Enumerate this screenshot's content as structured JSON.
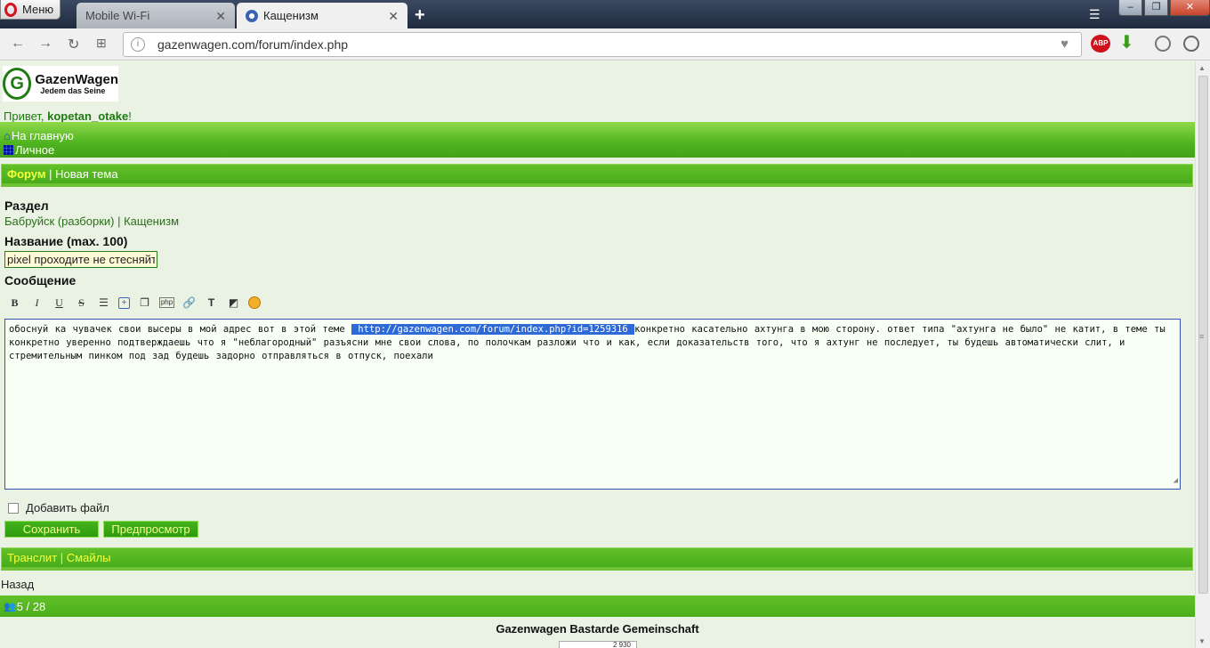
{
  "browser": {
    "menu_label": "Меню",
    "tabs": [
      {
        "title": "Mobile Wi-Fi",
        "active": false
      },
      {
        "title": "Кащенизм",
        "active": true
      }
    ],
    "url": "gazenwagen.com/forum/index.php"
  },
  "site": {
    "logo_name": "GazenWagen",
    "logo_slogan": "Jedem das Seine",
    "greeting_prefix": "Привет, ",
    "username": "kopetan_otake",
    "greeting_suffix": "!",
    "nav": {
      "home": "На главную",
      "personal": "Личное"
    }
  },
  "breadcrumb": {
    "forum": "Форум",
    "sep": " | ",
    "new_topic": "Новая тема"
  },
  "form": {
    "section_label": "Раздел",
    "section_path": "Бабруйск (разборки) | Кащенизм",
    "title_label": "Название (max. 100)",
    "title_value": "pixel проходите не стесняйт",
    "message_label": "Сообщение",
    "toolbar": [
      "B",
      "I",
      "U",
      "S",
      "list",
      "spoiler",
      "copy",
      "php",
      "link",
      "text-color",
      "bg-color",
      "smiles"
    ],
    "message_before": "обоснуй ка чувачек свои высеры в мой адрес вот в этой теме ",
    "message_link": " http://gazenwagen.com/forum/index.php?id=1259316 ",
    "message_after": "конкретно касательно ахтунга в мою сторону. ответ типа \"ахтунга не было\" не катит, в теме ты конкретно уверенно подтверждаешь что я \"неблагородный\" разъясни мне свои слова, по полочкам разложи что и как, если доказательств того, что я ахтунг не последует, ты будешь автоматически слит, и стремительным пинком под зад будешь задорно отправляться в отпуск, поехали",
    "attach_label": "Добавить файл",
    "save_label": "Сохранить",
    "preview_label": "Предпросмотр"
  },
  "tools_bar": {
    "translit": "Транслит",
    "sep": " | ",
    "smiles": "Смайлы"
  },
  "back_label": "Назад",
  "online_count": "5 / 28",
  "footer_text": "Gazenwagen Bastarde Gemeinschaft",
  "counter_text": "2 930"
}
